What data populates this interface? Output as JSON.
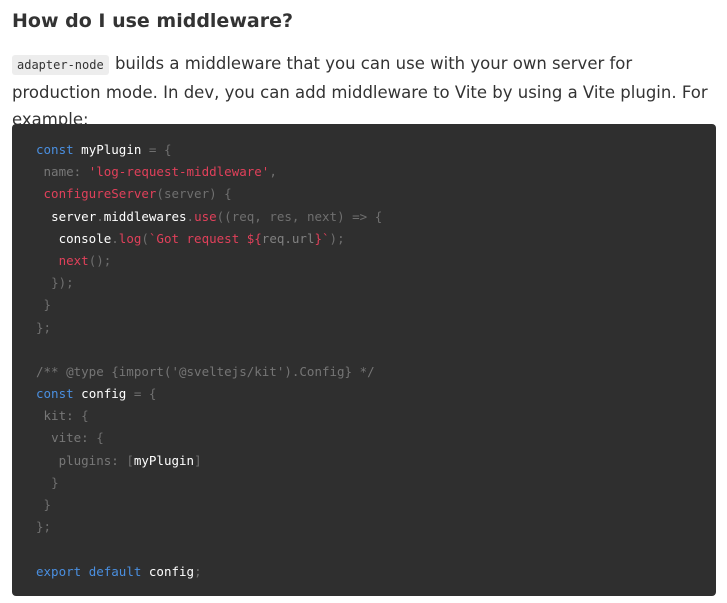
{
  "heading": "How do I use middleware?",
  "paragraph": {
    "code_term": "adapter-node",
    "text": " builds a middleware that you can use with your own server for production mode. In dev, you can add middleware to Vite by using a Vite plugin. For example:"
  },
  "code_block": {
    "lines": [
      [
        {
          "t": "keyword",
          "v": "const"
        },
        {
          "t": "plain",
          "v": " "
        },
        {
          "t": "ident",
          "v": "myPlugin"
        },
        {
          "t": "punct",
          "v": " = {"
        }
      ],
      [
        {
          "t": "plain",
          "v": " "
        },
        {
          "t": "prop",
          "v": "name:"
        },
        {
          "t": "plain",
          "v": " "
        },
        {
          "t": "string",
          "v": "'log-request-middleware'"
        },
        {
          "t": "punct",
          "v": ","
        }
      ],
      [
        {
          "t": "plain",
          "v": " "
        },
        {
          "t": "fn",
          "v": "configureServer"
        },
        {
          "t": "punct",
          "v": "(server) {"
        }
      ],
      [
        {
          "t": "plain",
          "v": "  "
        },
        {
          "t": "ident",
          "v": "server"
        },
        {
          "t": "punct",
          "v": "."
        },
        {
          "t": "ident",
          "v": "middlewares"
        },
        {
          "t": "punct",
          "v": "."
        },
        {
          "t": "fn",
          "v": "use"
        },
        {
          "t": "punct",
          "v": "((req, res, next) => {"
        }
      ],
      [
        {
          "t": "plain",
          "v": "   "
        },
        {
          "t": "ident",
          "v": "console"
        },
        {
          "t": "punct",
          "v": "."
        },
        {
          "t": "fn",
          "v": "log"
        },
        {
          "t": "punct",
          "v": "("
        },
        {
          "t": "string",
          "v": "`Got request ${"
        },
        {
          "t": "plain",
          "v": "req.url"
        },
        {
          "t": "string",
          "v": "}`"
        },
        {
          "t": "punct",
          "v": ");"
        }
      ],
      [
        {
          "t": "plain",
          "v": "   "
        },
        {
          "t": "fn",
          "v": "next"
        },
        {
          "t": "punct",
          "v": "();"
        }
      ],
      [
        {
          "t": "plain",
          "v": "  "
        },
        {
          "t": "punct",
          "v": "});"
        }
      ],
      [
        {
          "t": "plain",
          "v": " "
        },
        {
          "t": "punct",
          "v": "}"
        }
      ],
      [
        {
          "t": "punct",
          "v": "};"
        }
      ],
      [],
      [
        {
          "t": "comment",
          "v": "/** @type {import('@sveltejs/kit').Config} */"
        }
      ],
      [
        {
          "t": "keyword",
          "v": "const"
        },
        {
          "t": "plain",
          "v": " "
        },
        {
          "t": "ident",
          "v": "config"
        },
        {
          "t": "punct",
          "v": " = {"
        }
      ],
      [
        {
          "t": "plain",
          "v": " "
        },
        {
          "t": "prop",
          "v": "kit:"
        },
        {
          "t": "punct",
          "v": " {"
        }
      ],
      [
        {
          "t": "plain",
          "v": "  "
        },
        {
          "t": "prop",
          "v": "vite:"
        },
        {
          "t": "punct",
          "v": " {"
        }
      ],
      [
        {
          "t": "plain",
          "v": "   "
        },
        {
          "t": "prop",
          "v": "plugins:"
        },
        {
          "t": "plain",
          "v": " "
        },
        {
          "t": "punct",
          "v": "["
        },
        {
          "t": "ident",
          "v": "myPlugin"
        },
        {
          "t": "punct",
          "v": "]"
        }
      ],
      [
        {
          "t": "plain",
          "v": "  "
        },
        {
          "t": "punct",
          "v": "}"
        }
      ],
      [
        {
          "t": "plain",
          "v": " "
        },
        {
          "t": "punct",
          "v": "}"
        }
      ],
      [
        {
          "t": "punct",
          "v": "};"
        }
      ],
      [],
      [
        {
          "t": "keyword",
          "v": "export"
        },
        {
          "t": "plain",
          "v": " "
        },
        {
          "t": "keyword",
          "v": "default"
        },
        {
          "t": "plain",
          "v": " "
        },
        {
          "t": "ident",
          "v": "config"
        },
        {
          "t": "punct",
          "v": ";"
        }
      ]
    ]
  },
  "colors": {
    "code_background": "#2f2f2f",
    "keyword": "#4a8fe0",
    "string": "#e0405a",
    "identifier": "#ffffff",
    "text": "#333333"
  }
}
